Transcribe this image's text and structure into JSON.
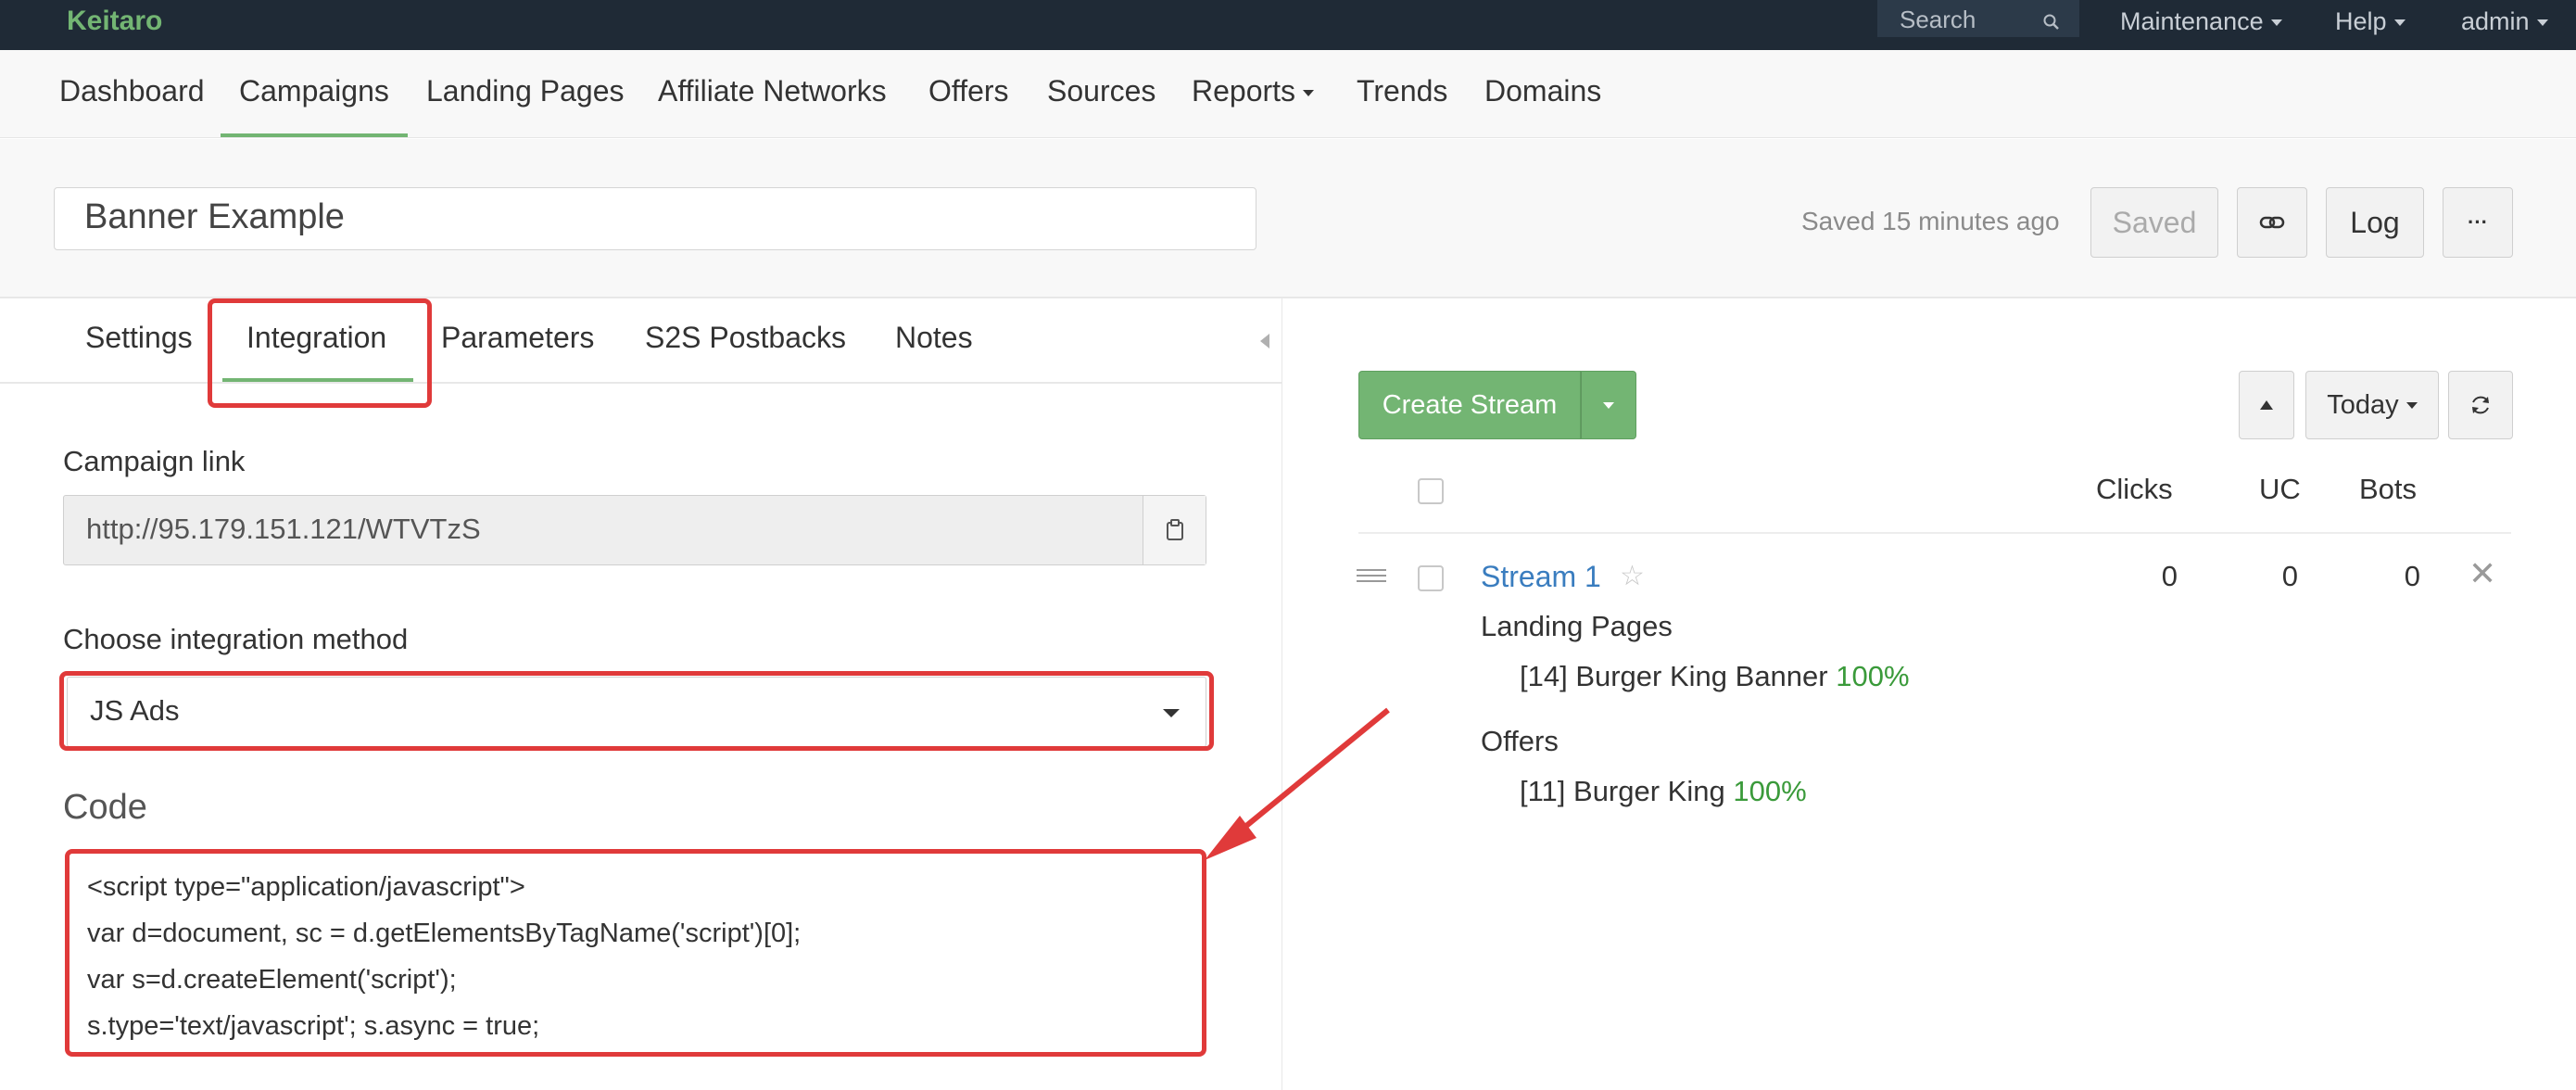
{
  "topbar": {
    "brand": "Keitaro",
    "search_placeholder": "Search",
    "maintenance": "Maintenance",
    "help": "Help",
    "admin": "admin"
  },
  "nav": {
    "items": [
      "Dashboard",
      "Campaigns",
      "Landing Pages",
      "Affiliate Networks",
      "Offers",
      "Sources",
      "Reports",
      "Trends",
      "Domains"
    ],
    "active": "Campaigns"
  },
  "campaign": {
    "name": "Banner Example",
    "saved_text": "Saved 15 minutes ago",
    "saved_button": "Saved",
    "log_button": "Log",
    "more_button": "···"
  },
  "tabs": [
    "Settings",
    "Integration",
    "Parameters",
    "S2S Postbacks",
    "Notes"
  ],
  "active_tab": "Integration",
  "integration": {
    "campaign_link_label": "Campaign link",
    "campaign_link": "http://95.179.151.121/WTVTzS",
    "method_label": "Choose integration method",
    "method_value": "JS Ads",
    "code_label": "Code",
    "code_lines": [
      "<script type=\"application/javascript\">",
      "var d=document, sc = d.getElementsByTagName('script')[0];",
      "var s=d.createElement('script');",
      "s.type='text/javascript'; s.async = true;"
    ]
  },
  "streams": {
    "create_button": "Create Stream",
    "period": "Today",
    "columns": [
      "Clicks",
      "UC",
      "Bots"
    ],
    "rows": [
      {
        "name": "Stream 1",
        "clicks": "0",
        "uc": "0",
        "bots": "0",
        "landing_pages_label": "Landing Pages",
        "landing_page": "[14] Burger King Banner",
        "landing_page_pct": "100%",
        "offers_label": "Offers",
        "offer": "[11] Burger King",
        "offer_pct": "100%"
      }
    ]
  },
  "colors": {
    "topbar_bg": "#1f2a36",
    "accent_green": "#73b573",
    "highlight_red": "#e03a3a",
    "link_blue": "#3a7dbf"
  }
}
